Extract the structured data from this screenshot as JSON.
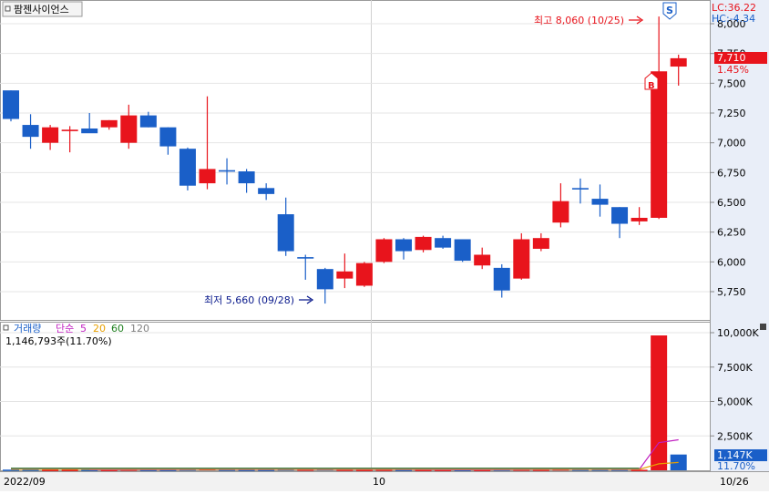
{
  "title": "팜젠사이언스",
  "colors": {
    "up": "#e8141c",
    "down": "#1a5fc8",
    "ma5": "#c020c0",
    "ma20": "#e8a000",
    "ma60": "#208020",
    "ma120": "#808080",
    "hilo": "#0a1a8c"
  },
  "header": {
    "lc": "LC:36.22",
    "hc": "HC:-4.34"
  },
  "price_axis": {
    "ticks": [
      "8,000",
      "7,750",
      "7,500",
      "7,250",
      "7,000",
      "6,750",
      "6,500",
      "6,250",
      "6,000",
      "5,750"
    ],
    "last_price": "7,710",
    "last_change": "1.45%"
  },
  "volume_panel": {
    "legend_label": "거래량",
    "legend_simple": "단순",
    "ma_periods": [
      "5",
      "20",
      "60",
      "120"
    ],
    "info": "1,146,793주(11.70%)",
    "ticks": [
      "10,000K",
      "7,500K",
      "5,000K",
      "2,500K"
    ],
    "last_volume": "1,147K",
    "last_ratio": "11.70%"
  },
  "x_axis": {
    "labels": [
      "2022/09",
      "10"
    ],
    "last_date": "10/26"
  },
  "annotations": {
    "high": "최고 8,060 (10/25)",
    "low": "최저 5,660 (09/28)",
    "badge_s": "S",
    "badge_b": "B"
  },
  "chart_data": [
    {
      "type": "candlestick",
      "title": "팜젠사이언스",
      "ylim": [
        5600,
        8100
      ],
      "y_ticks": [
        5750,
        6000,
        6250,
        6500,
        6750,
        7000,
        7250,
        7500,
        7750,
        8000
      ],
      "x_labels": [
        "2022/09",
        "10"
      ],
      "ohlc": [
        [
          7440,
          7440,
          7180,
          7200
        ],
        [
          7150,
          7240,
          6950,
          7050
        ],
        [
          7000,
          7150,
          6940,
          7130
        ],
        [
          7100,
          7140,
          6920,
          7110
        ],
        [
          7120,
          7250,
          7090,
          7080
        ],
        [
          7130,
          7190,
          7110,
          7190
        ],
        [
          7000,
          7320,
          6950,
          7230
        ],
        [
          7230,
          7260,
          7130,
          7130
        ],
        [
          7130,
          7130,
          6900,
          6970
        ],
        [
          6950,
          6960,
          6600,
          6640
        ],
        [
          6660,
          7390,
          6610,
          6780
        ],
        [
          6770,
          6870,
          6650,
          6760
        ],
        [
          6760,
          6780,
          6580,
          6660
        ],
        [
          6620,
          6660,
          6520,
          6570
        ],
        [
          6400,
          6540,
          6050,
          6090
        ],
        [
          6040,
          6060,
          5850,
          6030
        ],
        [
          5940,
          5950,
          5650,
          5770
        ],
        [
          5860,
          6070,
          5780,
          5920
        ],
        [
          5800,
          6000,
          5790,
          5990
        ],
        [
          6000,
          6200,
          5990,
          6190
        ],
        [
          6190,
          6200,
          6020,
          6090
        ],
        [
          6100,
          6220,
          6080,
          6210
        ],
        [
          6200,
          6220,
          6110,
          6120
        ],
        [
          6190,
          6190,
          6000,
          6010
        ],
        [
          5970,
          6120,
          5940,
          6060
        ],
        [
          5950,
          5980,
          5700,
          5760
        ],
        [
          5860,
          6240,
          5850,
          6190
        ],
        [
          6110,
          6240,
          6090,
          6200
        ],
        [
          6330,
          6660,
          6290,
          6510
        ],
        [
          6620,
          6700,
          6490,
          6610
        ],
        [
          6530,
          6650,
          6380,
          6480
        ],
        [
          6460,
          6460,
          6200,
          6320
        ],
        [
          6340,
          6460,
          6310,
          6370
        ],
        [
          6370,
          8060,
          6360,
          7600
        ],
        [
          7640,
          7740,
          7480,
          7710
        ]
      ],
      "x_label_positions": [
        0,
        18
      ]
    },
    {
      "type": "bar",
      "title": "거래량",
      "ylabel": "",
      "ylim": [
        0,
        10500
      ],
      "y_ticks": [
        2500,
        5000,
        7500,
        10000
      ],
      "values": [
        50,
        50,
        40,
        40,
        40,
        40,
        60,
        40,
        40,
        70,
        110,
        50,
        40,
        40,
        80,
        60,
        90,
        50,
        40,
        50,
        40,
        40,
        40,
        40,
        40,
        60,
        60,
        50,
        80,
        60,
        60,
        60,
        40,
        9800,
        1147
      ],
      "directions": [
        "down",
        "down",
        "up",
        "up",
        "down",
        "up",
        "up",
        "down",
        "down",
        "down",
        "up",
        "down",
        "down",
        "down",
        "down",
        "up",
        "down",
        "up",
        "up",
        "up",
        "down",
        "up",
        "up",
        "down",
        "up",
        "down",
        "up",
        "up",
        "up",
        "down",
        "down",
        "down",
        "up",
        "up",
        "down"
      ],
      "ma5": [
        null,
        null,
        null,
        null,
        44,
        42,
        44,
        44,
        44,
        50,
        64,
        62,
        60,
        62,
        64,
        54,
        62,
        56,
        56,
        58,
        54,
        44,
        42,
        42,
        40,
        44,
        48,
        52,
        62,
        64,
        66,
        60,
        60,
        2004,
        2221
      ]
    }
  ]
}
